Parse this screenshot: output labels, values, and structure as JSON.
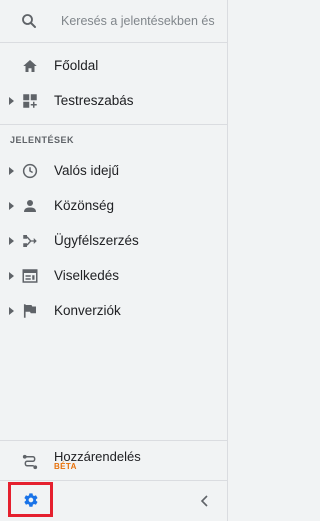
{
  "search": {
    "placeholder": "Keresés a jelentésekben és"
  },
  "nav": {
    "home": "Főoldal",
    "customization": "Testreszabás"
  },
  "reports": {
    "section_title": "JELENTÉSEK",
    "items": [
      {
        "label": "Valós idejű",
        "icon": "clock-icon"
      },
      {
        "label": "Közönség",
        "icon": "person-icon"
      },
      {
        "label": "Ügyfélszerzés",
        "icon": "acquisition-icon"
      },
      {
        "label": "Viselkedés",
        "icon": "behavior-icon"
      },
      {
        "label": "Konverziók",
        "icon": "flag-icon"
      }
    ]
  },
  "attribution": {
    "label": "Hozzárendelés",
    "badge": "BÉTA"
  },
  "colors": {
    "accent": "#1a73e8",
    "highlight": "#e5202e",
    "beta": "#e8710a"
  }
}
